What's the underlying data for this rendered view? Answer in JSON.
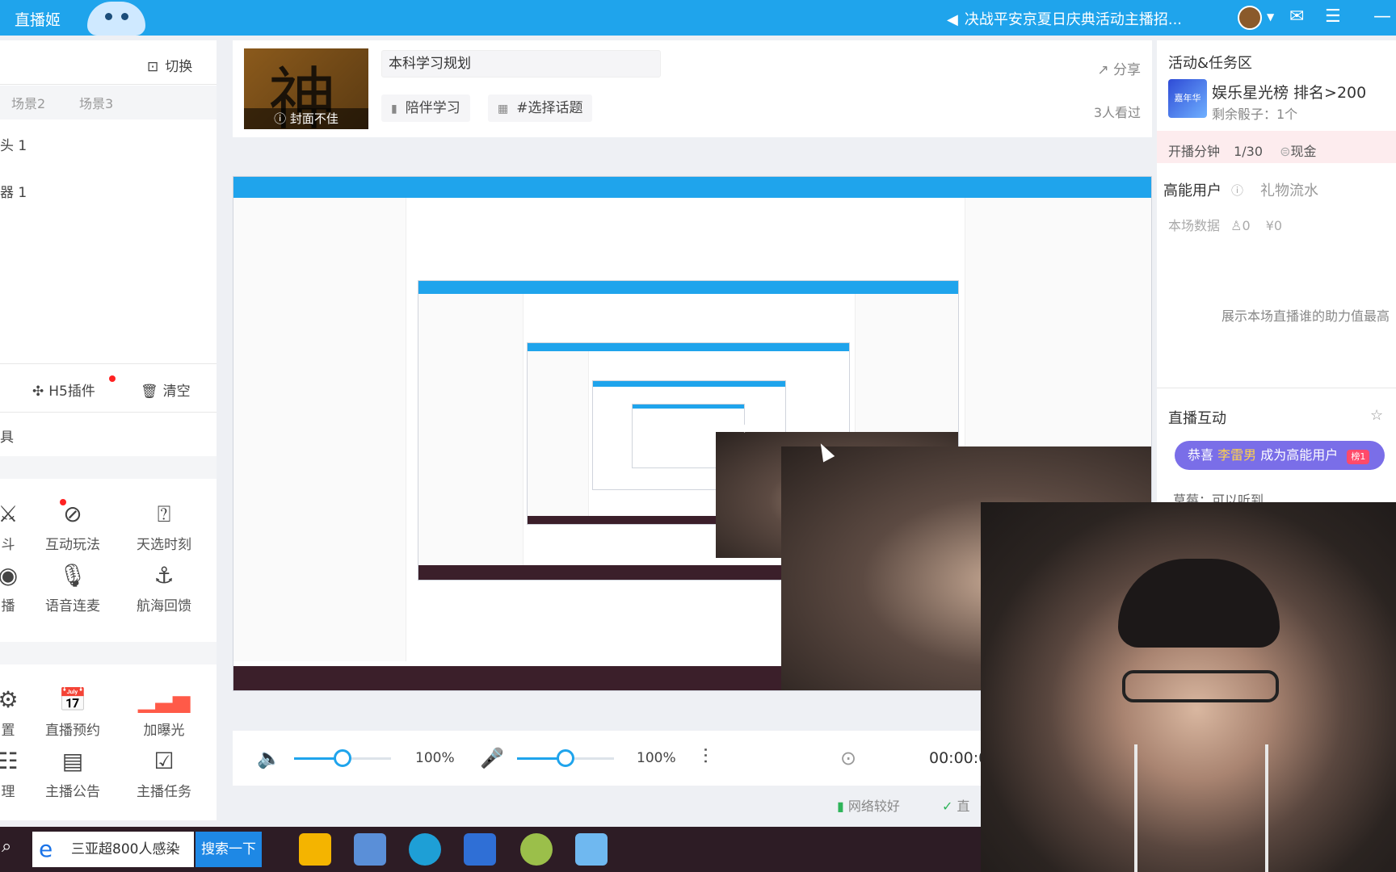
{
  "titlebar": {
    "app_name": "直播姬",
    "notice": "决战平安京夏日庆典活动主播招...",
    "speaker_icon": "speaker-icon",
    "color": "#1fa4ec"
  },
  "left_panel": {
    "switch_label": "切换",
    "scene_tabs": [
      "场景2",
      "场景3"
    ],
    "sources": [
      "头 1",
      "器 1"
    ],
    "h5_label": "H5插件",
    "clear_label": "清空",
    "tools_header": "具",
    "tools": [
      {
        "label": "斗",
        "icon": "pk-icon"
      },
      {
        "label": "互动玩法",
        "icon": "interactive-play-icon"
      },
      {
        "label": "天选时刻",
        "icon": "lucky-draw-icon"
      },
      {
        "label": "播",
        "icon": "virtual-broadcast-icon"
      },
      {
        "label": "语音连麦",
        "icon": "voice-link-icon"
      },
      {
        "label": "航海回馈",
        "icon": "anchor-icon"
      },
      {
        "label": "置",
        "icon": "settings-icon"
      },
      {
        "label": "直播预约",
        "icon": "calendar-icon"
      },
      {
        "label": "加曝光",
        "icon": "boost-icon"
      },
      {
        "label": "理",
        "icon": "manage-icon"
      },
      {
        "label": "主播公告",
        "icon": "announcement-icon"
      },
      {
        "label": "主播任务",
        "icon": "task-icon"
      }
    ]
  },
  "info": {
    "cover_glyph": "神",
    "cover_warning": "封面不佳",
    "title": "本科学习规划",
    "category": "陪伴学习",
    "topic": "#选择话题",
    "share": "分享",
    "viewers": "3人看过"
  },
  "audio": {
    "speaker_volume": "100%",
    "mic_volume": "100%",
    "speaker_level": 0.5,
    "mic_level": 0.5,
    "timer": "00:00:0"
  },
  "status": {
    "network": "网络较好",
    "live": "直"
  },
  "right_panel": {
    "activity_title": "活动&任务区",
    "rank_text": "娱乐星光榜 排名>200",
    "dice_text": "剩余骰子：1个",
    "rank_icon_label": "嘉年华",
    "stream_minutes": "开播分钟",
    "stream_progress": "1/30",
    "cash_label": "现金",
    "high_energy": "高能用户",
    "gift_flow": "礼物流水",
    "session_data": "本场数据",
    "count_value": "0",
    "money_value": "¥0",
    "assist_hint": "展示本场直播谁的助力值最高",
    "live_interaction": "直播互动",
    "congrats_prefix": "恭喜",
    "congrats_name": "李雷男",
    "congrats_suffix": "成为高能用户",
    "badge": "榜1",
    "chat_preview": "草莓：可以听到"
  },
  "taskbar": {
    "search_text": "三亚超800人感染",
    "search_button": "搜索一下"
  }
}
